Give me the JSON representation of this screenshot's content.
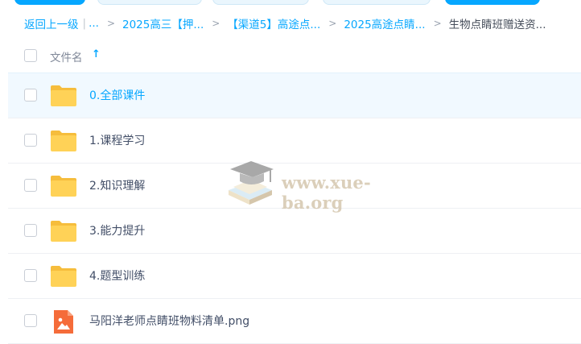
{
  "colors": {
    "accent": "#06a7ff",
    "folder": "#ffd257",
    "folder_tab": "#f6bd3c",
    "image_file": "#f56c3a",
    "row_hover": "#f1f9ff"
  },
  "breadcrumb": {
    "back": "返回上一级",
    "pipe": "|",
    "ellipsis": "...",
    "separator": ">",
    "items": [
      "2025高三【押...",
      "【渠道5】高途点...",
      "2025高途点睛...",
      "生物点睛班赠送资..."
    ]
  },
  "header": {
    "name_column": "文件名",
    "sort_icon": "arrow-up-icon",
    "sort_glyph": "↑"
  },
  "files": [
    {
      "name": "0.全部课件",
      "icon": "folder-icon"
    },
    {
      "name": "1.课程学习",
      "icon": "folder-icon"
    },
    {
      "name": "2.知识理解",
      "icon": "folder-icon"
    },
    {
      "name": "3.能力提升",
      "icon": "folder-icon"
    },
    {
      "name": "4.题型训练",
      "icon": "folder-icon"
    },
    {
      "name": "马阳洋老师点睛班物料清单.png",
      "icon": "image-file-icon"
    }
  ],
  "watermark": {
    "text": "www.xue-ba.org",
    "icon": "graduation-cap-icon"
  }
}
